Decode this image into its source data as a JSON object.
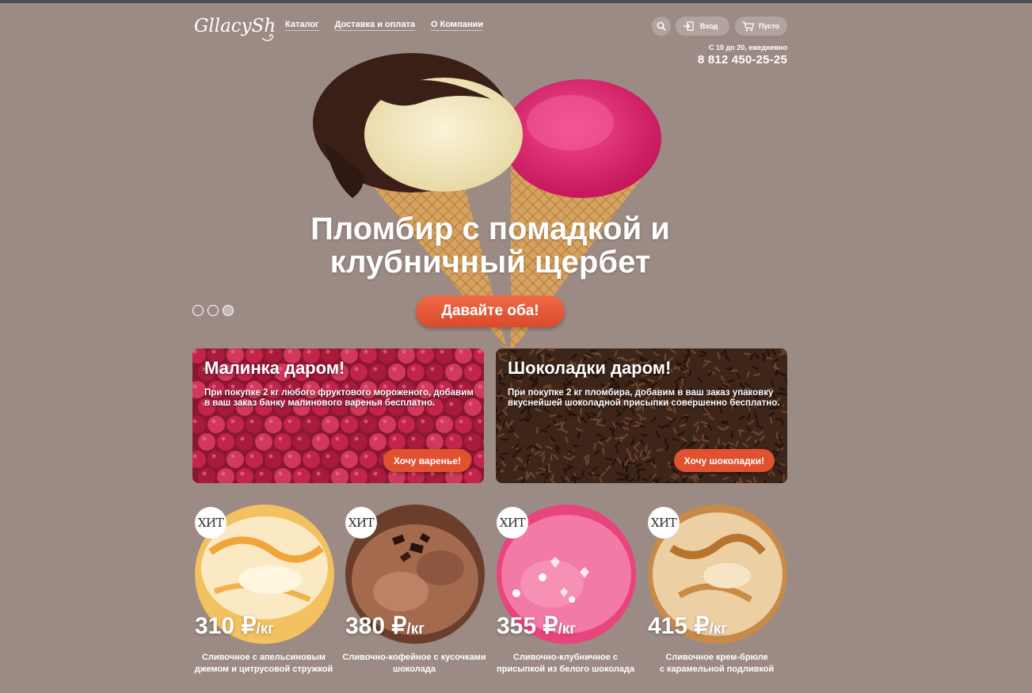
{
  "header": {
    "logo_text": "GllacyShop",
    "nav": [
      "Каталог",
      "Доставка и оплата",
      "О Компании"
    ],
    "login_label": "Вход",
    "cart_label": "Пусто",
    "hours": "С 10 до 20, ежедневно",
    "phone": "8 812 450-25-25"
  },
  "hero": {
    "title_line1": "Пломбир с помадкой и",
    "title_line2": "клубничный щербет",
    "button": "Давайте оба!",
    "slides": 3,
    "active_slide": 3
  },
  "promos": [
    {
      "title": "Малинка даром!",
      "text": "При покупке 2 кг любого фруктового мороженого, добавим в ваш заказ банку малинового варенья бесплатно.",
      "button": "Хочу варенье!"
    },
    {
      "title": "Шоколадки даром!",
      "text": "При покупке 2 кг пломбира, добавим в ваш заказ упаковку вкуснейшей шоколадной присыпки совершенно бесплатно.",
      "button": "Хочу шоколадки!"
    }
  ],
  "products": [
    {
      "badge": "ХИТ",
      "price": "310 ₽",
      "unit": "/кг",
      "desc_line1": "Сливочное с апельсиновым",
      "desc_line2": "джемом и цитрусовой стружкой"
    },
    {
      "badge": "ХИТ",
      "price": "380 ₽",
      "unit": "/кг",
      "desc_line1": "Сливочно-кофейное с кусочками",
      "desc_line2": "шоколада"
    },
    {
      "badge": "ХИТ",
      "price": "355 ₽",
      "unit": "/кг",
      "desc_line1": "Сливочно-клубничное с",
      "desc_line2": "присыпкой из белого шоколада"
    },
    {
      "badge": "ХИТ",
      "price": "415 ₽",
      "unit": "/кг",
      "desc_line1": "Сливочное крем-брюле",
      "desc_line2": "с карамельной подливкой"
    }
  ],
  "colors": {
    "background": "#9c8b84",
    "accent": "#e0512f",
    "topbar": "#4a4d57"
  },
  "icons": [
    "search-icon",
    "login-icon",
    "cart-icon"
  ]
}
